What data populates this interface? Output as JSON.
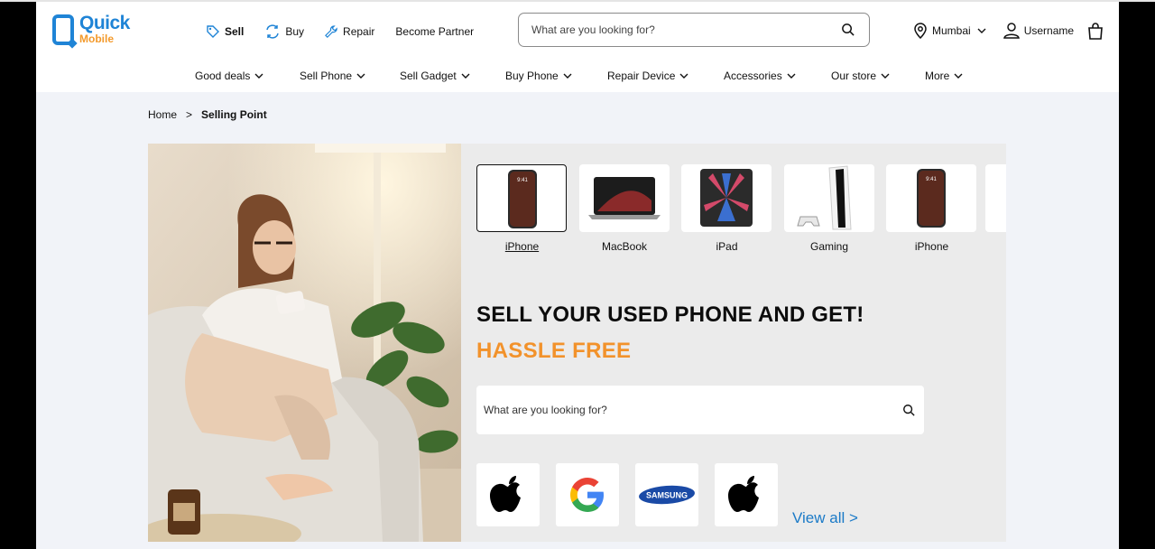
{
  "brand": {
    "name_top": "Quick",
    "name_bottom": "Mobile"
  },
  "topnav": [
    {
      "label": "Sell",
      "icon": "tag-icon"
    },
    {
      "label": "Buy",
      "icon": "exchange-icon"
    },
    {
      "label": "Repair",
      "icon": "wrench-icon"
    },
    {
      "label": "Become Partner"
    }
  ],
  "search": {
    "placeholder": "What are you looking for?"
  },
  "location": {
    "city": "Mumbai"
  },
  "user": {
    "name": "Username"
  },
  "categories": [
    "Good deals",
    "Sell Phone",
    "Sell Gadget",
    "Buy Phone",
    "Repair Device",
    "Accessories",
    "Our store",
    "More"
  ],
  "breadcrumb": {
    "home": "Home",
    "separator": ">",
    "current": "Selling Point"
  },
  "products": [
    "iPhone",
    "MacBook",
    "iPad",
    "Gaming",
    "iPhone"
  ],
  "hero": {
    "headline": "SELL YOUR USED PHONE AND GET!",
    "subline": "HASSLE FREE",
    "search_placeholder": "What are you looking for?",
    "view_all": "View all >"
  },
  "brands": [
    "apple-logo",
    "google-logo",
    "samsung-logo",
    "apple-logo"
  ],
  "samsung_text": "SAMSUNG",
  "colors": {
    "accent_blue": "#1f84d6",
    "accent_orange": "#f2922b"
  }
}
